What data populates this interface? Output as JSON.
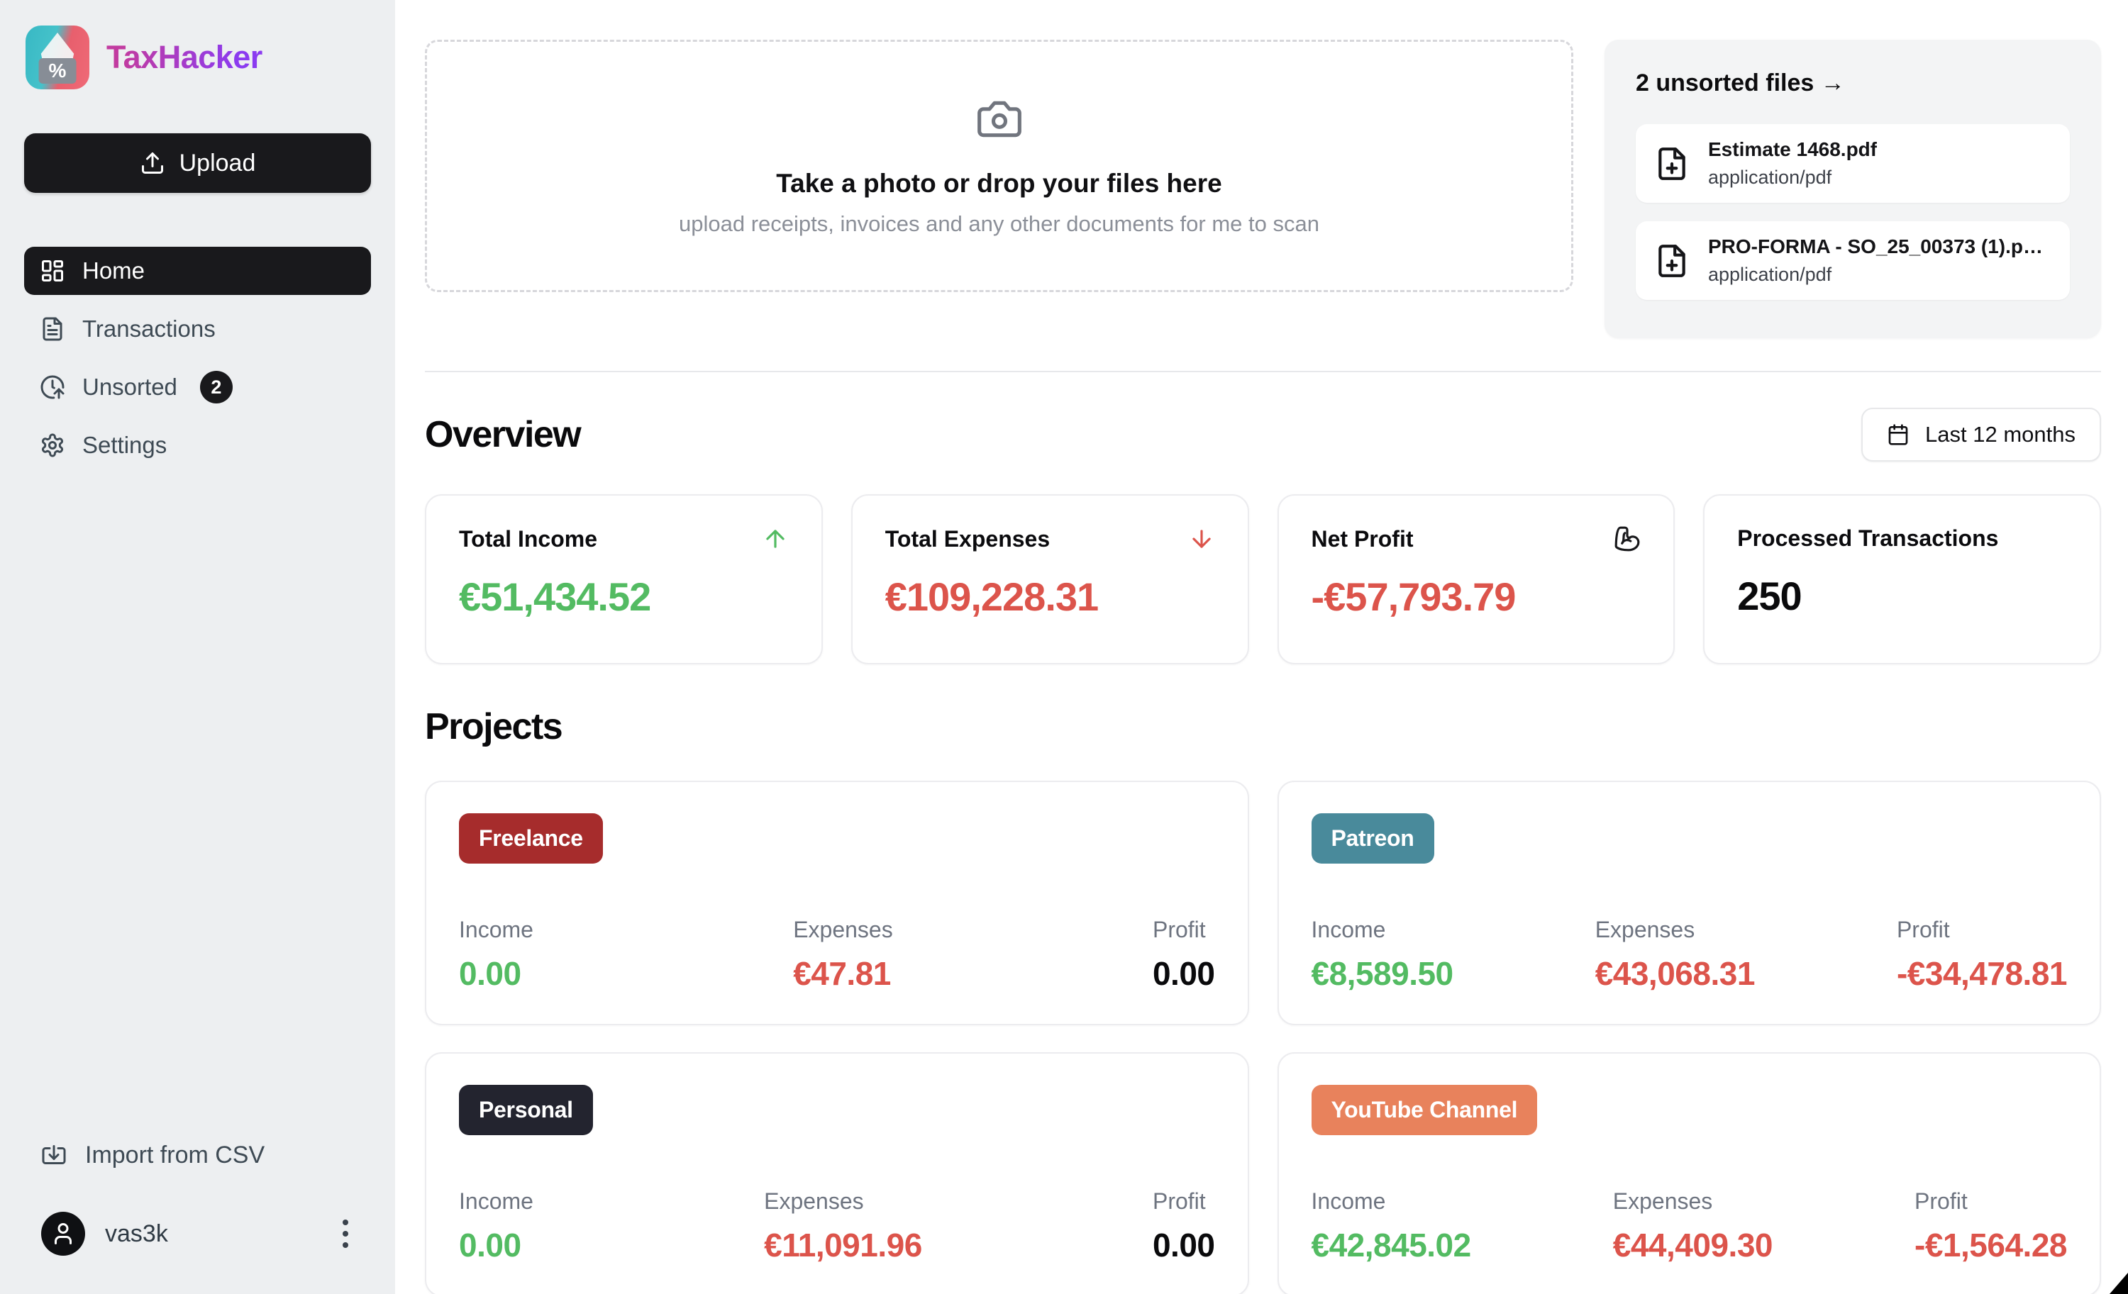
{
  "app": {
    "title": "TaxHacker"
  },
  "sidebar": {
    "upload_label": "Upload",
    "nav": [
      {
        "label": "Home",
        "active": true
      },
      {
        "label": "Transactions",
        "active": false
      },
      {
        "label": "Unsorted",
        "active": false,
        "badge": "2"
      },
      {
        "label": "Settings",
        "active": false
      }
    ],
    "import_label": "Import from CSV",
    "user": {
      "name": "vas3k"
    }
  },
  "dropzone": {
    "title": "Take a photo or drop your files here",
    "subtitle": "upload receipts, invoices and any other documents for me to scan"
  },
  "unsorted_panel": {
    "title": "2 unsorted files →",
    "files": [
      {
        "name": "Estimate 1468.pdf",
        "type": "application/pdf"
      },
      {
        "name": "PRO-FORMA - SO_25_00373 (1).p…",
        "type": "application/pdf"
      }
    ]
  },
  "overview": {
    "heading": "Overview",
    "range_label": "Last 12 months",
    "stats": [
      {
        "label": "Total Income",
        "value": "€51,434.52",
        "icon": "arrow-up-icon"
      },
      {
        "label": "Total Expenses",
        "value": "€109,228.31",
        "icon": "arrow-down-icon"
      },
      {
        "label": "Net Profit",
        "value": "-€57,793.79",
        "icon": "biceps-flexed-icon"
      },
      {
        "label": "Processed Transactions",
        "value": "250",
        "icon": "none"
      }
    ]
  },
  "projects": {
    "heading": "Projects",
    "labels": {
      "income": "Income",
      "expenses": "Expenses",
      "profit": "Profit"
    },
    "cards": [
      {
        "name": "Freelance",
        "badge_color": "#a62c2c",
        "income": "0.00",
        "expenses": "€47.81",
        "profit": "0.00"
      },
      {
        "name": "Patreon",
        "badge_color": "#498a9b",
        "income": "€8,589.50",
        "expenses": "€43,068.31",
        "profit": "-€34,478.81"
      },
      {
        "name": "Personal",
        "badge_color": "#23242f",
        "income": "0.00",
        "expenses": "€11,091.96",
        "profit": "0.00"
      },
      {
        "name": "YouTube Channel",
        "badge_color": "#e8825c",
        "income": "€42,845.02",
        "expenses": "€44,409.30",
        "profit": "-€1,564.28"
      }
    ]
  },
  "colors": {
    "income_green": "#53bb62",
    "expense_red": "#dc544b",
    "sidebar_bg": "#edeff1",
    "active_nav_bg": "#19191c",
    "title_gradient_start": "#c23ba0",
    "title_gradient_end": "#8b3bf0"
  }
}
